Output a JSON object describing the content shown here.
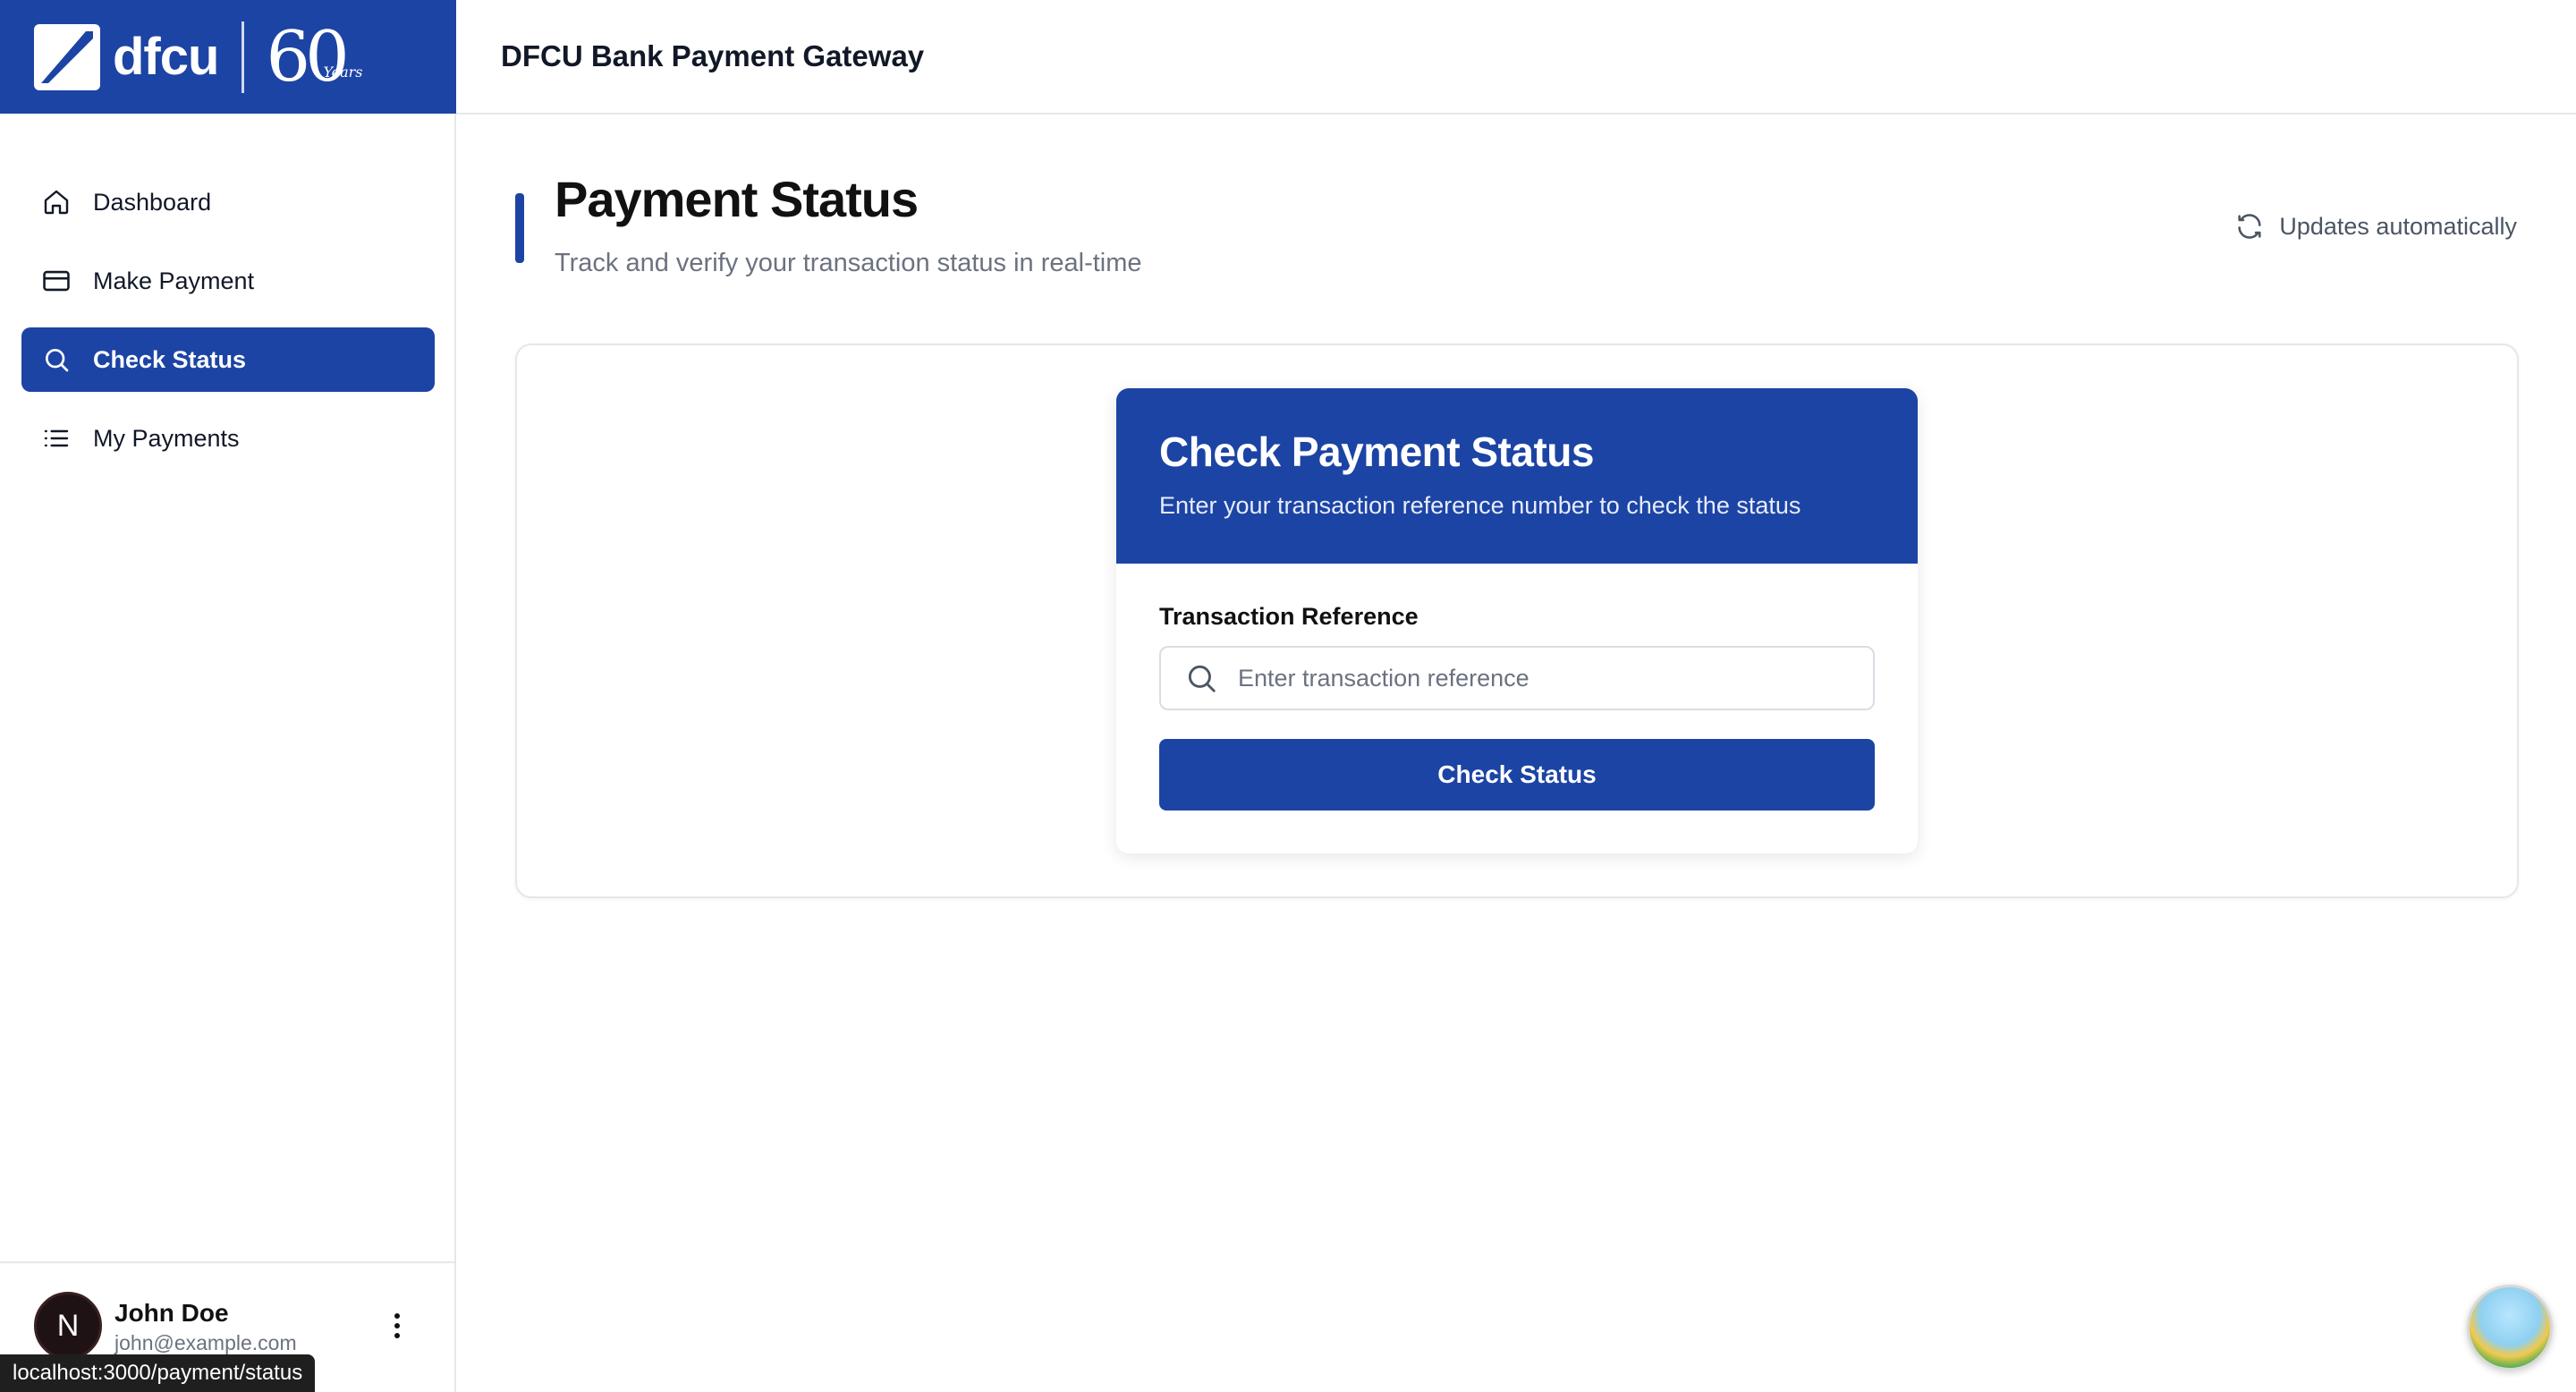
{
  "brand": {
    "name": "dfcu",
    "anniversary": "60",
    "anniversary_script": "Years"
  },
  "topbar": {
    "title": "DFCU Bank Payment Gateway"
  },
  "sidebar": {
    "items": [
      {
        "label": "Dashboard",
        "icon": "home-icon",
        "active": false
      },
      {
        "label": "Make Payment",
        "icon": "credit-card-icon",
        "active": false
      },
      {
        "label": "Check Status",
        "icon": "search-icon",
        "active": true
      },
      {
        "label": "My Payments",
        "icon": "list-icon",
        "active": false
      }
    ]
  },
  "user": {
    "initial": "N",
    "name": "John Doe",
    "email": "john@example.com"
  },
  "status_bar": {
    "url": "localhost:3000/payment/status"
  },
  "page": {
    "title": "Payment Status",
    "subtitle": "Track and verify your transaction status in real-time",
    "updates_label": "Updates automatically"
  },
  "check_card": {
    "title": "Check Payment Status",
    "subtitle": "Enter your transaction reference number to check the status",
    "field_label": "Transaction Reference",
    "input_value": "",
    "input_placeholder": "Enter transaction reference",
    "button_label": "Check Status"
  },
  "colors": {
    "accent": "#1c44a4",
    "muted_text": "#6b7280",
    "border": "#e5e7eb"
  }
}
